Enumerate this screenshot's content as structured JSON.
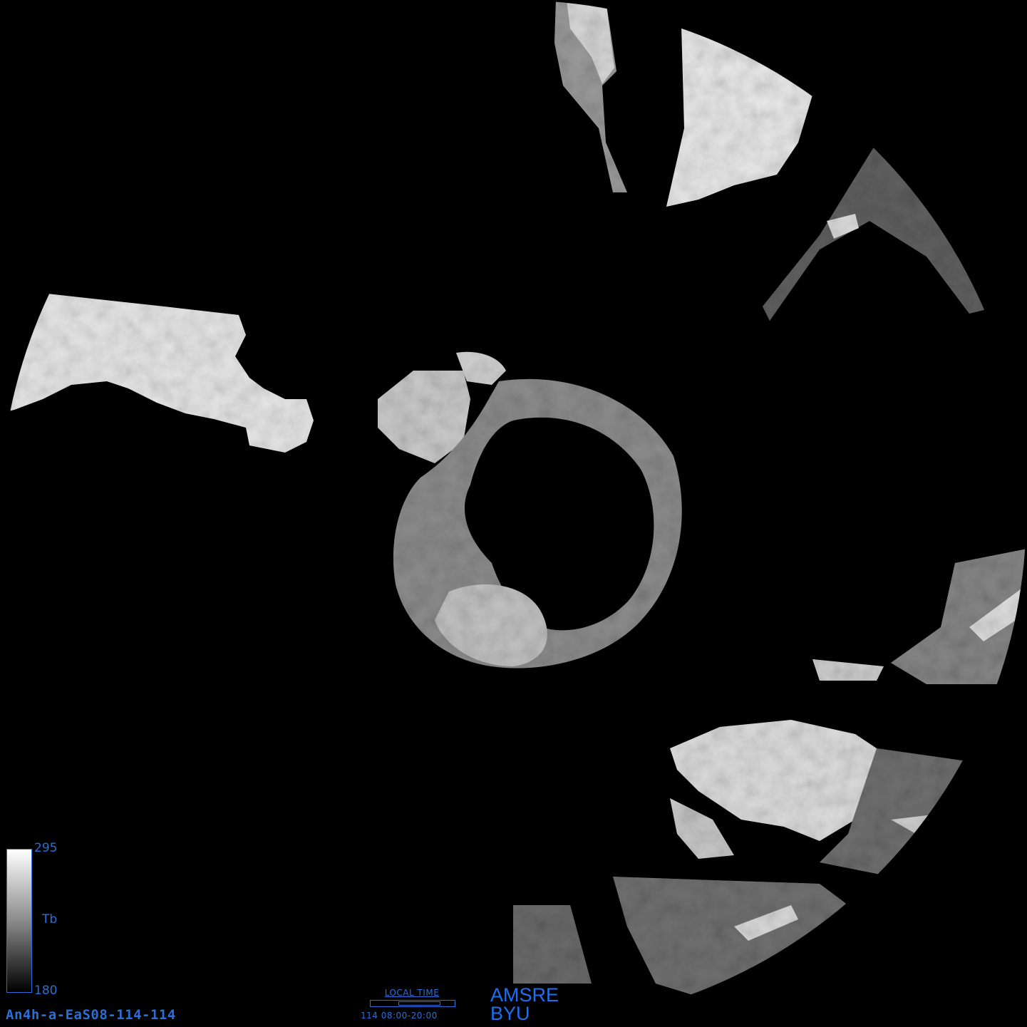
{
  "colorbar": {
    "max": "295",
    "mid": "Tb",
    "min": "180"
  },
  "file_id": "An4h-a-EaS08-114-114",
  "local_time": {
    "title": "LOCAL TIME",
    "range": "114 08:00-20:00",
    "start_fraction": 0.333,
    "end_fraction": 0.833
  },
  "sensor": {
    "name": "AMSRE",
    "org": "BYU"
  },
  "colors": {
    "label_blue": "#2a6fd6",
    "sensor_blue": "#1d6ff2",
    "background": "#000000"
  }
}
